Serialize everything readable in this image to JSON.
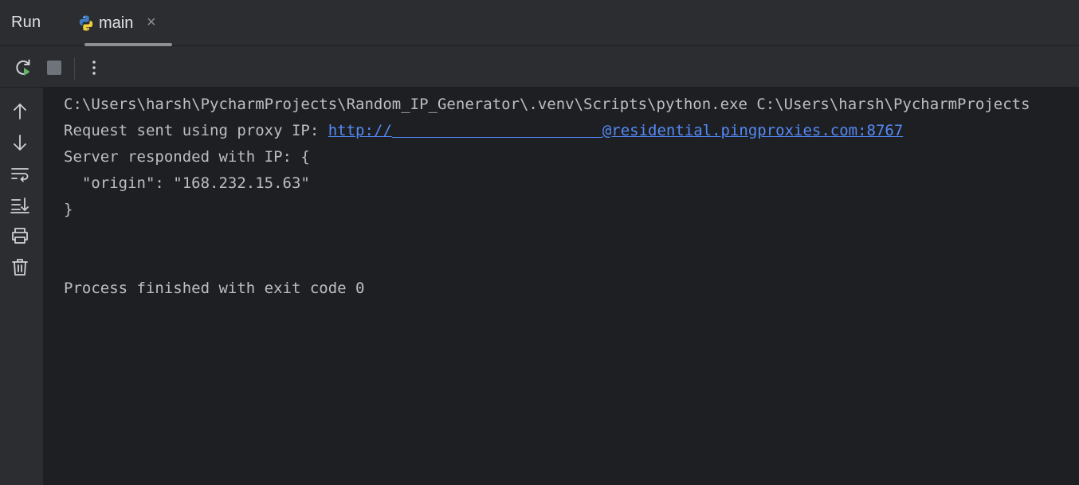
{
  "header": {
    "title": "Run",
    "tab": {
      "label": "main",
      "close": "×"
    }
  },
  "console": {
    "command": "C:\\Users\\harsh\\PycharmProjects\\Random_IP_Generator\\.venv\\Scripts\\python.exe C:\\Users\\harsh\\PycharmProjects",
    "request_prefix": "Request sent using proxy IP: ",
    "proxy_link_start": "http://",
    "proxy_link_end": "@residential.pingproxies.com:8767",
    "server_line": "Server responded with IP: {",
    "origin_line": "  \"origin\": \"168.232.15.63\"",
    "close_brace": "}",
    "exit_line": "Process finished with exit code 0"
  },
  "icons": {
    "toolbar": [
      "rerun-icon",
      "stop-icon",
      "more-icon"
    ],
    "sidebar": [
      "up-arrow-icon",
      "down-arrow-icon",
      "soft-wrap-icon",
      "scroll-to-end-icon",
      "print-icon",
      "trash-icon"
    ]
  },
  "colors": {
    "background": "#1e1f22",
    "panel": "#2b2d30",
    "text": "#bcbec4",
    "link": "#548af7",
    "run_green": "#5fb865"
  }
}
